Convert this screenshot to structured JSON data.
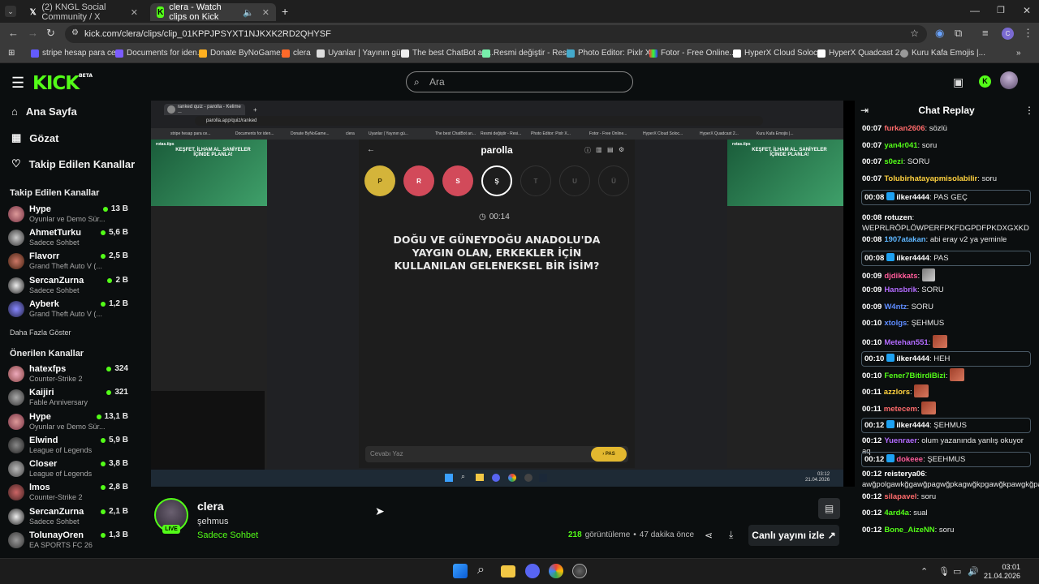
{
  "browser": {
    "tabs": [
      {
        "label": "(2) KNGL Social Community / X"
      },
      {
        "label": "clera - Watch clips on Kick"
      }
    ],
    "url": "kick.com/clera/clips/clip_01KPPJPSYXT1NJKXK2RD2QHYSF",
    "bookmarks": [
      "stripe hesap para ce...",
      "Documents for iden...",
      "Donate ByNoGame...",
      "clera",
      "Uyanlar | Yayının gü...",
      "The best ChatBot an...",
      "Resmi değiştir - Resi...",
      "Photo Editor: Pixlr X...",
      "Fotor - Free Online...",
      "HyperX Cloud Soloc...",
      "HyperX Quadcast 2...",
      "Kuru Kafa Emojis |..."
    ]
  },
  "kick": {
    "logo": "KICK",
    "logo_beta": "BETA",
    "search_placeholder": "Ara",
    "nav": [
      {
        "label": "Ana Sayfa"
      },
      {
        "label": "Gözat"
      },
      {
        "label": "Takip Edilen Kanallar"
      }
    ],
    "followed_title": "Takip Edilen Kanallar",
    "followed": [
      {
        "name": "Hype",
        "sub": "Oyunlar ve Demo Sür...",
        "viewers": "13 B"
      },
      {
        "name": "AhmetTurku",
        "sub": "Sadece Sohbet",
        "viewers": "5,6 B"
      },
      {
        "name": "Flavorr",
        "sub": "Grand Theft Auto V (...",
        "viewers": "2,5 B"
      },
      {
        "name": "SercanZurna",
        "sub": "Sadece Sohbet",
        "viewers": "2 B"
      },
      {
        "name": "Ayberk",
        "sub": "Grand Theft Auto V (...",
        "viewers": "1,2 B"
      }
    ],
    "show_more": "Daha Fazla Göster",
    "recommended_title": "Önerilen Kanallar",
    "recommended": [
      {
        "name": "hatexfps",
        "sub": "Counter-Strike 2",
        "viewers": "324"
      },
      {
        "name": "Kaijiri",
        "sub": "Fable Anniversary",
        "viewers": "321"
      },
      {
        "name": "Hype",
        "sub": "Oyunlar ve Demo Sür...",
        "viewers": "13,1 B"
      },
      {
        "name": "Elwind",
        "sub": "League of Legends",
        "viewers": "5,9 B"
      },
      {
        "name": "Closer",
        "sub": "League of Legends",
        "viewers": "3,8 B"
      },
      {
        "name": "lmos",
        "sub": "Counter-Strike 2",
        "viewers": "2,8 B"
      },
      {
        "name": "SercanZurna",
        "sub": "Sadece Sohbet",
        "viewers": "2,1 B"
      },
      {
        "name": "TolunayOren",
        "sub": "EA SPORTS FC 26",
        "viewers": "1,3 B"
      }
    ]
  },
  "game": {
    "inner_tab": "ranked quiz - parolla - Kelime ...",
    "inner_url": "parolla.app/quiz/ranked",
    "title": "parolla",
    "letters": [
      "P",
      "R",
      "S",
      "Ş",
      "T",
      "U",
      "Ü"
    ],
    "timer": "00:14",
    "question": "DOĞU VE GÜNEYDOĞU ANADOLU'DA YAYGIN OLAN, ERKEKLER İÇİN KULLANILAN GELENEKSEL BİR İSİM?",
    "answer_placeholder": "Cevabı Yaz",
    "pass_label": "PAS",
    "ad_text": "KEŞFET, İLHAM AL. SANİYELER İÇİNDE PLANLA!",
    "ad_brand": "rotas.tips",
    "inner_clock_time": "03:12",
    "inner_clock_date": "21.04.2026"
  },
  "clip": {
    "streamer": "clera",
    "clip_title": "şehmus",
    "category": "Sadece Sohbet",
    "live": "LIVE",
    "views": "218",
    "views_label": "görüntüleme",
    "ago": "47 dakika önce",
    "watch_live": "Canlı yayını izle"
  },
  "chat": {
    "title": "Chat Replay",
    "messages": [
      {
        "time": "00:07",
        "user": "furkan2606",
        "color": "#ff6b6b",
        "text": "sözlü"
      },
      {
        "time": "00:07",
        "user": "yan4r041",
        "color": "#53fc18",
        "text": "soru"
      },
      {
        "time": "00:07",
        "user": "s0ezi",
        "color": "#53fc18",
        "text": "SORU"
      },
      {
        "time": "00:07",
        "user": "Tolubirhatayapmisolabilir",
        "color": "#ffd23f",
        "text": "soru"
      },
      {
        "time": "00:08",
        "user": "ilker4444",
        "color": "#ffffff",
        "text": "PAS GEÇ",
        "boxed": true
      },
      {
        "time": "00:08",
        "user": "rotuzen",
        "color": "#ffffff",
        "text": "WEPRLRÖPLÖWPERFPKFDGPDFPKDXGXKD"
      },
      {
        "time": "00:08",
        "user": "1907atakan",
        "color": "#5eb6ff",
        "text": "abi eray v2 ya yeminle"
      },
      {
        "time": "00:08",
        "user": "ilker4444",
        "color": "#ffffff",
        "text": "PAS",
        "boxed": true
      },
      {
        "time": "00:09",
        "user": "djdikkats",
        "color": "#ff5b9a",
        "text": "",
        "emote": "face"
      },
      {
        "time": "00:09",
        "user": "Hansbrik",
        "color": "#b36bff",
        "text": "SORU"
      },
      {
        "time": "00:09",
        "user": "W4ntz",
        "color": "#5e8cff",
        "text": "SORU"
      },
      {
        "time": "00:10",
        "user": "xtolgs",
        "color": "#5e8cff",
        "text": "ŞEHMUS"
      },
      {
        "time": "00:10",
        "user": "Metehan551",
        "color": "#b36bff",
        "text": "",
        "emote": "red"
      },
      {
        "time": "00:10",
        "user": "ilker4444",
        "color": "#ffffff",
        "text": "HEH",
        "boxed": true
      },
      {
        "time": "00:10",
        "user": "Fener7BitirdiBizi",
        "color": "#53fc18",
        "text": "",
        "emote": "red"
      },
      {
        "time": "00:11",
        "user": "azzlors",
        "color": "#ffd23f",
        "text": "",
        "emote": "red"
      },
      {
        "time": "00:11",
        "user": "metecem",
        "color": "#ff6b6b",
        "text": "",
        "emote": "red"
      },
      {
        "time": "00:12",
        "user": "ilker4444",
        "color": "#ffffff",
        "text": "ŞEHMUS",
        "boxed": true
      },
      {
        "time": "00:12",
        "user": "Yuenraer",
        "color": "#b36bff",
        "text": "olum yazanında yanlış okuyor aq"
      },
      {
        "time": "00:12",
        "user": "dokeee",
        "color": "#ff5b9a",
        "text": "ŞEEHMUS",
        "boxed": true
      },
      {
        "time": "00:12",
        "user": "reisterya06",
        "color": "#ffffff",
        "text": "awğpolgawkğgawğpagwğpkagwğkpgawğkpawgkğpagw"
      },
      {
        "time": "00:12",
        "user": "silapavel",
        "color": "#ff6b6b",
        "text": "soru"
      },
      {
        "time": "00:12",
        "user": "4ard4a",
        "color": "#53fc18",
        "text": "sual"
      },
      {
        "time": "00:12",
        "user": "Bone_AizeNN",
        "color": "#53fc18",
        "text": "soru"
      }
    ]
  },
  "system": {
    "time": "03:01",
    "date": "21.04.2026"
  },
  "colors": {
    "accent": "#53fc18",
    "background": "#0b0e0f",
    "pass_button": "#e3b82f"
  }
}
